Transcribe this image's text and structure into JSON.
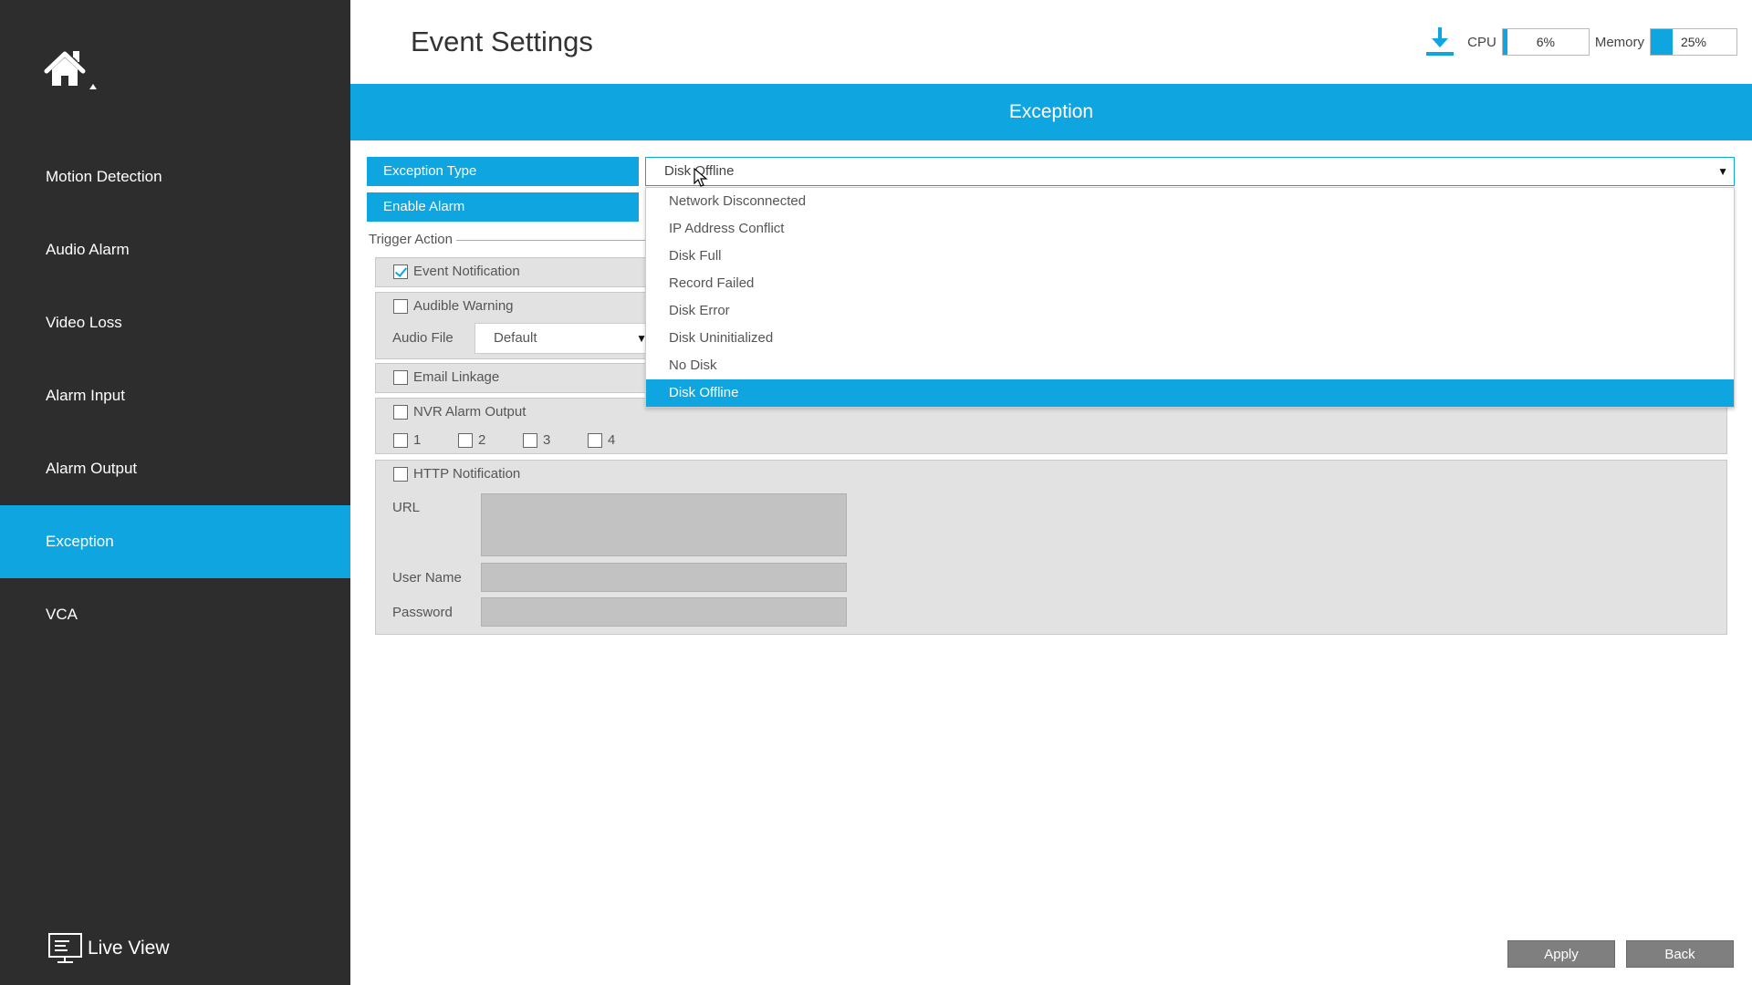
{
  "sidebar": {
    "home_icon": "home-icon",
    "items": [
      {
        "label": "Motion Detection",
        "active": false
      },
      {
        "label": "Audio Alarm",
        "active": false
      },
      {
        "label": "Video Loss",
        "active": false
      },
      {
        "label": "Alarm Input",
        "active": false
      },
      {
        "label": "Alarm Output",
        "active": false
      },
      {
        "label": "Exception",
        "active": true
      },
      {
        "label": "VCA",
        "active": false
      }
    ],
    "live_view_label": "Live View"
  },
  "header": {
    "title": "Event Settings",
    "cpu_label": "CPU",
    "cpu_value": "6%",
    "cpu_percent": 6,
    "memory_label": "Memory",
    "memory_value": "25%",
    "memory_percent": 25
  },
  "section": {
    "title": "Exception"
  },
  "form": {
    "exception_type_label": "Exception Type",
    "exception_type_value": "Disk Offline",
    "enable_alarm_label": "Enable Alarm",
    "trigger_action_label": "Trigger Action",
    "event_notification": {
      "label": "Event Notification",
      "checked": true
    },
    "audible_warning": {
      "label": "Audible Warning",
      "checked": false
    },
    "audio_file_label": "Audio File",
    "audio_file_value": "Default",
    "email_linkage": {
      "label": "Email Linkage",
      "checked": false
    },
    "nvr_alarm_output": {
      "label": "NVR Alarm Output",
      "checked": false
    },
    "outputs": [
      "1",
      "2",
      "3",
      "4"
    ],
    "http_notification": {
      "label": "HTTP Notification",
      "checked": false
    },
    "url_label": "URL",
    "user_name_label": "User Name",
    "password_label": "Password"
  },
  "dropdown": {
    "options": [
      "Network Disconnected",
      "IP Address Conflict",
      "Disk Full",
      "Record Failed",
      "Disk Error",
      "Disk Uninitialized",
      "No Disk",
      "Disk Offline"
    ],
    "selected": "Disk Offline"
  },
  "footer": {
    "apply_label": "Apply",
    "back_label": "Back"
  },
  "colors": {
    "accent": "#0ea5e0",
    "sidebar": "#2d2d2d",
    "panel": "#e2e2e2"
  }
}
